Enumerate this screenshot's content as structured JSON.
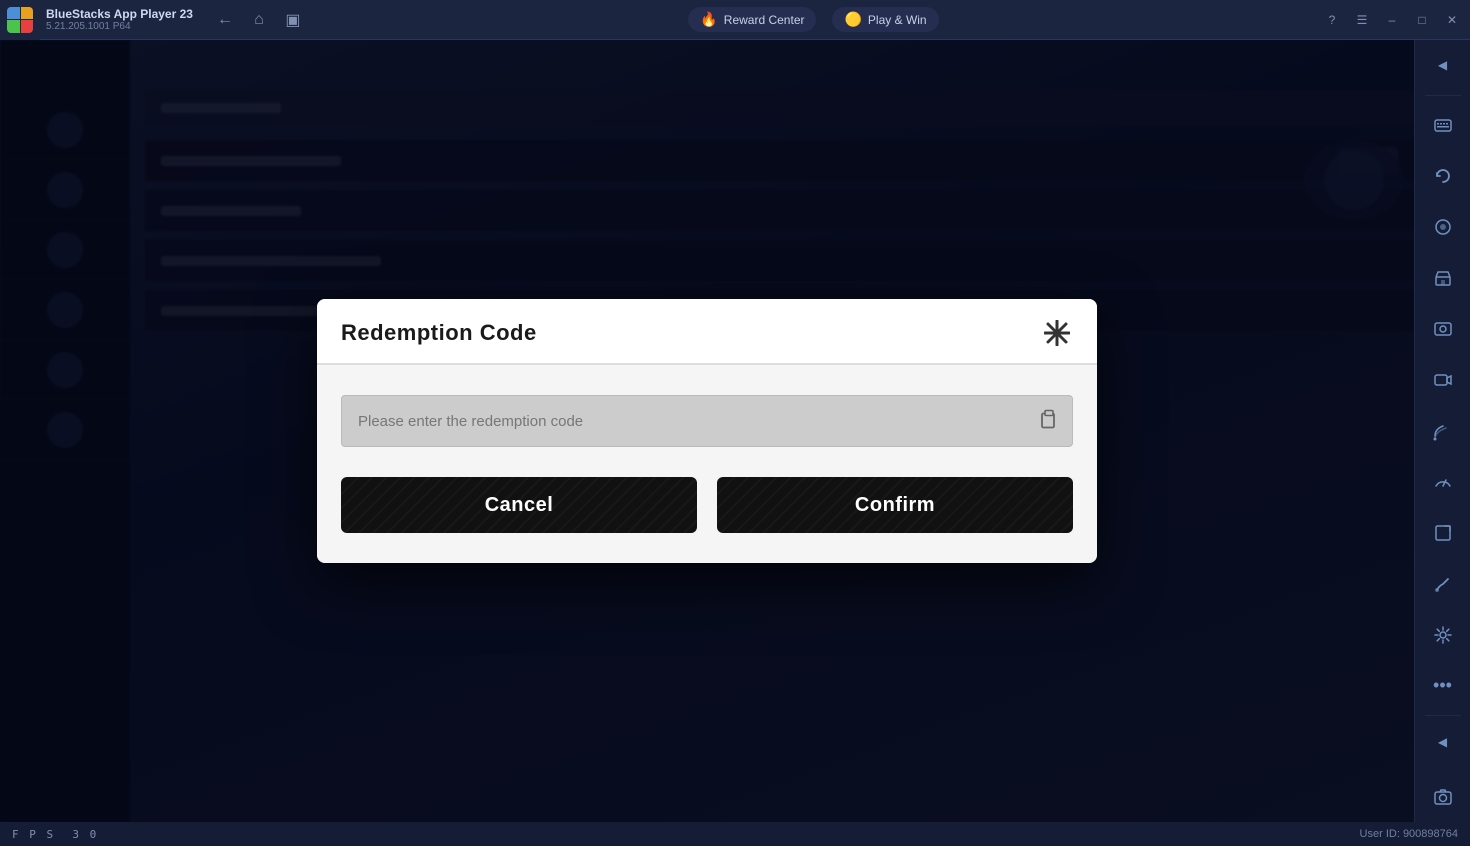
{
  "titlebar": {
    "app_name": "BlueStacks App Player 23",
    "app_version": "5.21.205.1001 P64",
    "reward_center_label": "Reward Center",
    "play_win_label": "Play & Win"
  },
  "dialog": {
    "title": "Redemption Code",
    "input_placeholder": "Please enter the redemption code",
    "cancel_label": "Cancel",
    "confirm_label": "Confirm"
  },
  "statusbar": {
    "fps_label": "F P S",
    "fps_value": "3 0",
    "user_id_label": "User ID: 900898764"
  },
  "sidebar": {
    "icons": [
      "⬅",
      "⬆",
      "⬛",
      "↩",
      "📱",
      "🔄",
      "🎯",
      "📸",
      "📹",
      "📡",
      "⚡",
      "🔁",
      "⚙",
      "•••",
      "⬅",
      "📷"
    ]
  }
}
